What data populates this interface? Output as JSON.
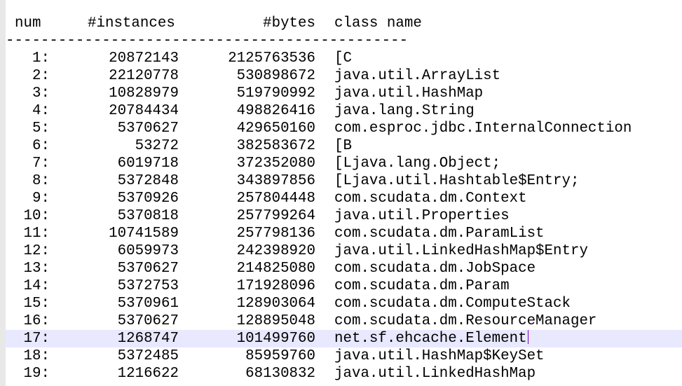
{
  "header": {
    "num": "num",
    "instances": "#instances",
    "bytes": "#bytes",
    "class_name": "class name"
  },
  "separator": "----------------------------------------------",
  "rows": [
    {
      "num": "1:",
      "instances": "20872143",
      "bytes": "2125763536",
      "class_name": "[C"
    },
    {
      "num": "2:",
      "instances": "22120778",
      "bytes": "530898672",
      "class_name": "java.util.ArrayList"
    },
    {
      "num": "3:",
      "instances": "10828979",
      "bytes": "519790992",
      "class_name": "java.util.HashMap"
    },
    {
      "num": "4:",
      "instances": "20784434",
      "bytes": "498826416",
      "class_name": "java.lang.String"
    },
    {
      "num": "5:",
      "instances": "5370627",
      "bytes": "429650160",
      "class_name": "com.esproc.jdbc.InternalConnection"
    },
    {
      "num": "6:",
      "instances": "53272",
      "bytes": "382583672",
      "class_name": "[B"
    },
    {
      "num": "7:",
      "instances": "6019718",
      "bytes": "372352080",
      "class_name": "[Ljava.lang.Object;"
    },
    {
      "num": "8:",
      "instances": "5372848",
      "bytes": "343897856",
      "class_name": "[Ljava.util.Hashtable$Entry;"
    },
    {
      "num": "9:",
      "instances": "5370926",
      "bytes": "257804448",
      "class_name": "com.scudata.dm.Context"
    },
    {
      "num": "10:",
      "instances": "5370818",
      "bytes": "257799264",
      "class_name": "java.util.Properties"
    },
    {
      "num": "11:",
      "instances": "10741589",
      "bytes": "257798136",
      "class_name": "com.scudata.dm.ParamList"
    },
    {
      "num": "12:",
      "instances": "6059973",
      "bytes": "242398920",
      "class_name": "java.util.LinkedHashMap$Entry"
    },
    {
      "num": "13:",
      "instances": "5370627",
      "bytes": "214825080",
      "class_name": "com.scudata.dm.JobSpace"
    },
    {
      "num": "14:",
      "instances": "5372753",
      "bytes": "171928096",
      "class_name": "com.scudata.dm.Param"
    },
    {
      "num": "15:",
      "instances": "5370961",
      "bytes": "128903064",
      "class_name": "com.scudata.dm.ComputeStack"
    },
    {
      "num": "16:",
      "instances": "5370627",
      "bytes": "128895048",
      "class_name": "com.scudata.dm.ResourceManager"
    },
    {
      "num": "17:",
      "instances": "1268747",
      "bytes": "101499760",
      "class_name": "net.sf.ehcache.Element"
    },
    {
      "num": "18:",
      "instances": "5372485",
      "bytes": "85959760",
      "class_name": "java.util.HashMap$KeySet"
    },
    {
      "num": "19:",
      "instances": "1216622",
      "bytes": "68130832",
      "class_name": "java.util.LinkedHashMap"
    }
  ],
  "current_line": 17,
  "colors": {
    "current_line_highlight": "#e8e8ff",
    "caret": "#7a00c8",
    "gutter": "#e8e8e8"
  }
}
